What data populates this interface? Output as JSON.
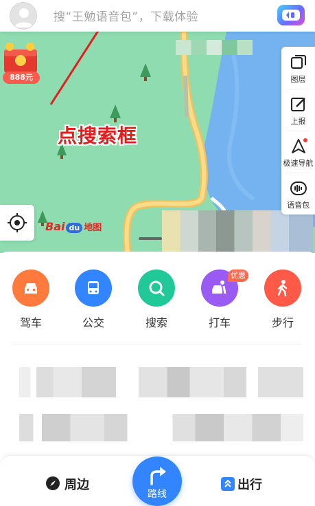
{
  "search": {
    "placeholder": "搜“王勉语音包”，下载体验"
  },
  "annotation": {
    "text": "点搜索框"
  },
  "promo": {
    "amount": "888元"
  },
  "tools": [
    {
      "label": "图层",
      "icon": "layers-icon"
    },
    {
      "label": "上报",
      "icon": "report-icon"
    },
    {
      "label": "极速导航",
      "icon": "navigation-arrow-icon"
    },
    {
      "label": "语音包",
      "icon": "voice-pack-icon"
    }
  ],
  "logo": {
    "bai": "Bai",
    "du": "du",
    "ditu": "地图"
  },
  "quick_actions": [
    {
      "label": "驾车",
      "icon": "car-icon",
      "color": "#ff7a3d"
    },
    {
      "label": "公交",
      "icon": "bus-icon",
      "color": "#3385ff"
    },
    {
      "label": "搜索",
      "icon": "search-icon",
      "color": "#20c997"
    },
    {
      "label": "打车",
      "icon": "taxi-icon",
      "color": "#9a5bf5"
    },
    {
      "label": "步行",
      "icon": "walk-icon",
      "color": "#ff5a47"
    }
  ],
  "taxi_tag": "优惠",
  "bottom_nav": {
    "nearby": "周边",
    "route": "路线",
    "travel": "出行"
  },
  "colors": {
    "accent": "#3385ff",
    "map_green": "#8fdcb0",
    "water": "#74b3f0",
    "road": "#f4cf6e"
  }
}
